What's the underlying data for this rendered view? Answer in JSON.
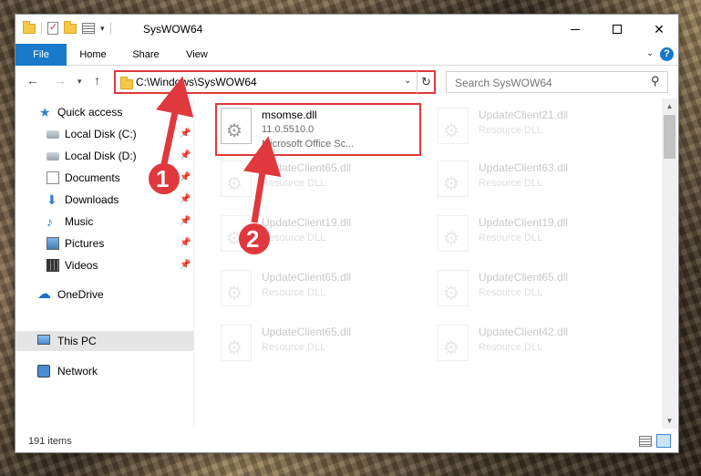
{
  "window": {
    "title": "SysWOW64"
  },
  "ribbon": {
    "tabs": [
      "File",
      "Home",
      "Share",
      "View"
    ]
  },
  "navbar": {
    "address": "C:\\Windows\\SysWOW64",
    "search_placeholder": "Search SysWOW64"
  },
  "sidebar": {
    "items": [
      {
        "label": "Quick access",
        "icon": "star-icon"
      },
      {
        "label": "Local Disk (C:)",
        "icon": "drive-icon",
        "pinned": true
      },
      {
        "label": "Local Disk (D:)",
        "icon": "drive-icon",
        "pinned": true
      },
      {
        "label": "Documents",
        "icon": "documents-icon",
        "pinned": true
      },
      {
        "label": "Downloads",
        "icon": "download-icon",
        "pinned": true
      },
      {
        "label": "Music",
        "icon": "music-icon",
        "pinned": true
      },
      {
        "label": "Pictures",
        "icon": "pictures-icon",
        "pinned": true
      },
      {
        "label": "Videos",
        "icon": "videos-icon",
        "pinned": true
      },
      {
        "label": "OneDrive",
        "icon": "cloud-icon"
      },
      {
        "label": "This PC",
        "icon": "computer-icon",
        "selected": true
      },
      {
        "label": "Network",
        "icon": "network-icon"
      }
    ]
  },
  "files": [
    {
      "name": "msomse.dll",
      "version": "11.0.5510.0",
      "desc": "Microsoft Office Sc...",
      "highlighted": true
    },
    {
      "name": "UpdateClient21.dll",
      "version": "Resource DLL"
    },
    {
      "name": "UpdateClient65.dll",
      "version": "Resource DLL"
    },
    {
      "name": "UpdateClient63.dll",
      "version": "Resource DLL"
    },
    {
      "name": "UpdateClient19.dll",
      "version": "Resource DLL"
    },
    {
      "name": "UpdateClient19.dll",
      "version": "Resource DLL"
    },
    {
      "name": "UpdateClient65.dll",
      "version": "Resource DLL"
    },
    {
      "name": "UpdateClient65.dll",
      "version": "Resource DLL"
    },
    {
      "name": "UpdateClient65.dll",
      "version": "Resource DLL"
    },
    {
      "name": "UpdateClient42.dll",
      "version": "Resource DLL"
    }
  ],
  "status": {
    "item_count": "191 items"
  },
  "annotations": {
    "badge1": "1",
    "badge2": "2"
  },
  "colors": {
    "accent": "#1979ca",
    "highlight_red": "#e0383d",
    "selected_bg": "#e5e5e5"
  }
}
